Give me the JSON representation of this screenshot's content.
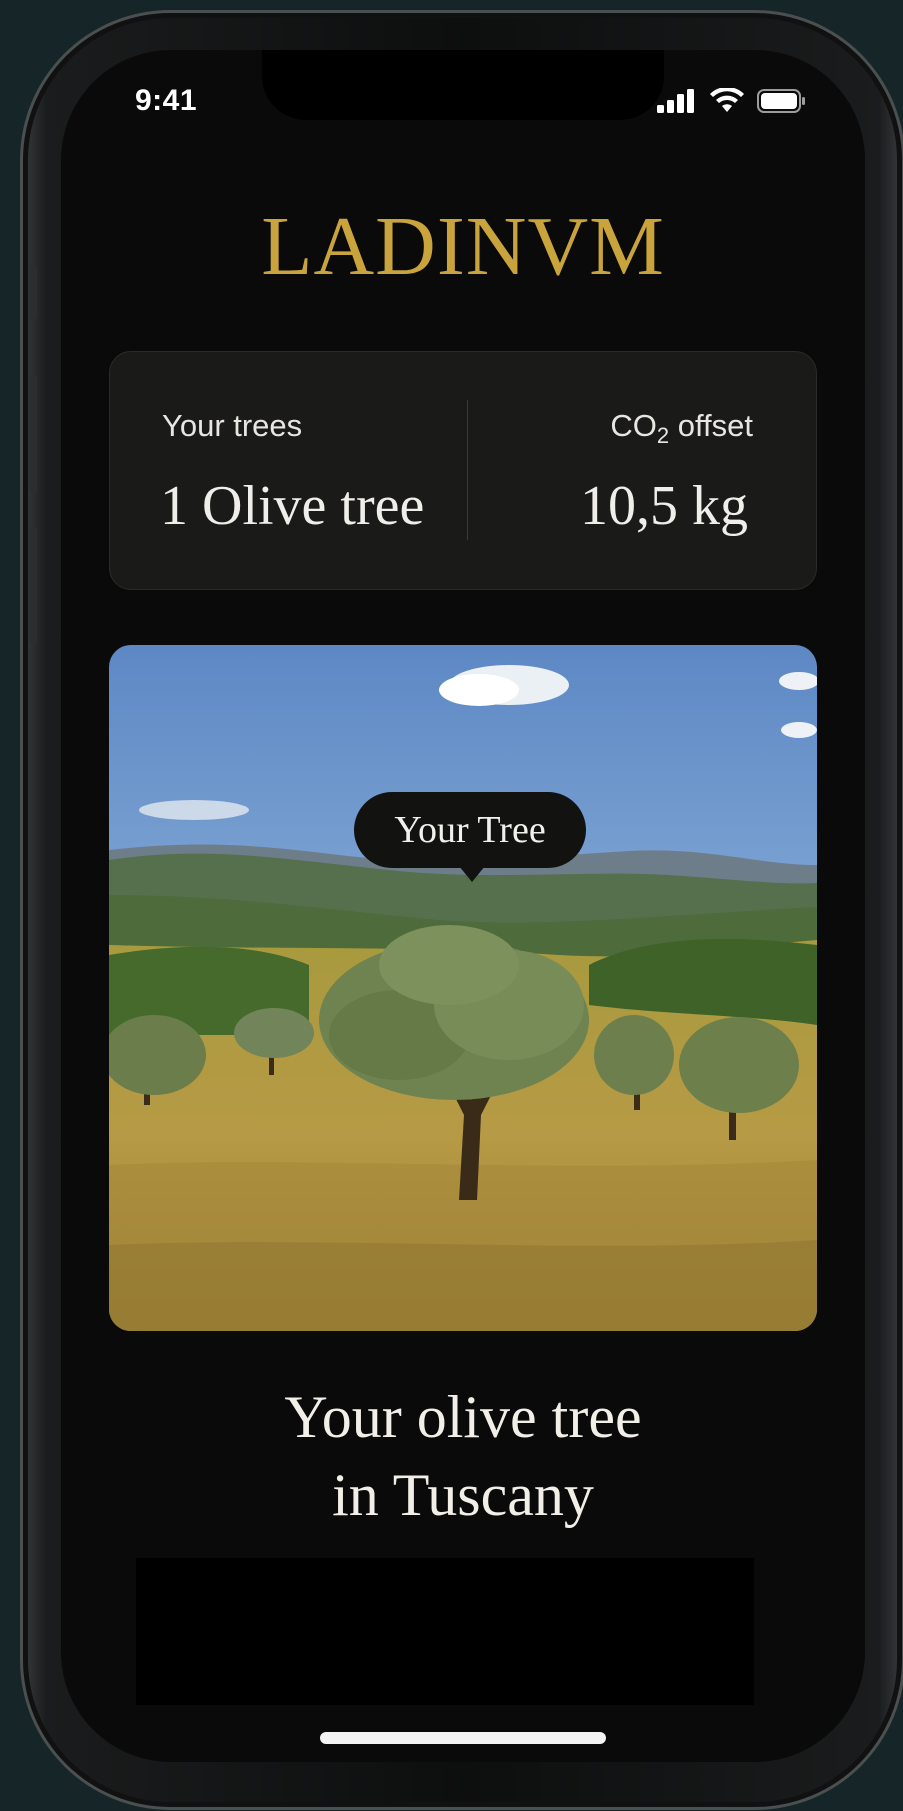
{
  "status_bar": {
    "time": "9:41",
    "icons": [
      "signal-icon",
      "wifi-icon",
      "battery-icon"
    ]
  },
  "brand": {
    "title": "LADINVM",
    "color": "#c9a33c"
  },
  "stats": {
    "trees_label": "Your trees",
    "trees_value": "1 Olive tree",
    "co2_label_prefix": "CO",
    "co2_label_sub": "2",
    "co2_label_suffix": " offset",
    "co2_value": "10,5 kg"
  },
  "photo": {
    "marker_label": "Your Tree"
  },
  "headline": {
    "line1": "Your olive tree",
    "line2": "in Tuscany"
  }
}
